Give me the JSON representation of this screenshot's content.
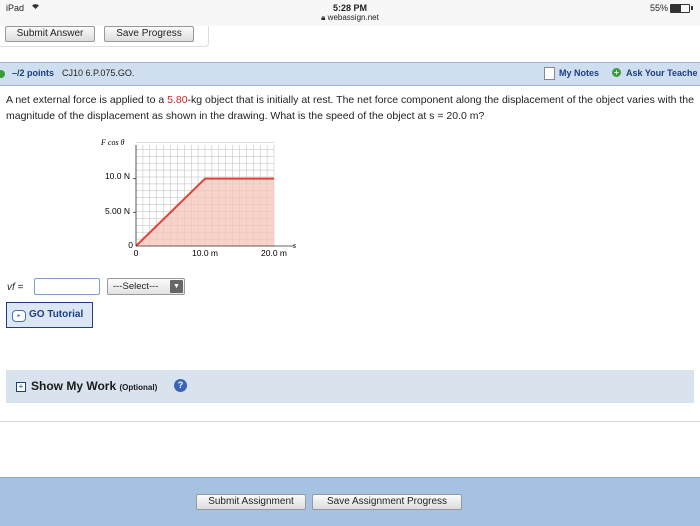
{
  "status_bar": {
    "device": "iPad",
    "time": "5:28 PM",
    "url": "webassign.net",
    "battery": "55%",
    "battery_level": 0.55
  },
  "top_actions": {
    "submit_answer": "Submit Answer",
    "save_progress": "Save Progress"
  },
  "question": {
    "points": "–/2 points",
    "id": "CJ10 6.P.075.GO.",
    "my_notes": "My Notes",
    "ask_teacher": "Ask Your Teache",
    "text_before": "A net external force is applied to a ",
    "mass": "5.80",
    "text_after": "-kg object that is initially at rest. The net force component along the displacement of the object varies with the magnitude of the displacement as shown in the drawing. What is the speed of the object at s = 20.0 m?"
  },
  "graph": {
    "y_axis_label": "F cos θ",
    "x_axis_label": "s",
    "y_ticks": [
      "10.0 N",
      "5.00 N",
      "0"
    ],
    "x_ticks": [
      "0",
      "10.0 m",
      "20.0 m"
    ],
    "points": [
      [
        0,
        0
      ],
      [
        10,
        10
      ],
      [
        20,
        10
      ]
    ],
    "fill_color": "#f4c4b8",
    "line_color": "#e0453a"
  },
  "answer": {
    "label": "vf =",
    "value": "",
    "unit_select": "---Select---"
  },
  "tutorial": {
    "label": "GO Tutorial"
  },
  "show_work": {
    "title": "Show My Work",
    "optional": "(Optional)"
  },
  "footer": {
    "submit_assignment": "Submit Assignment",
    "save_assignment": "Save Assignment Progress"
  }
}
